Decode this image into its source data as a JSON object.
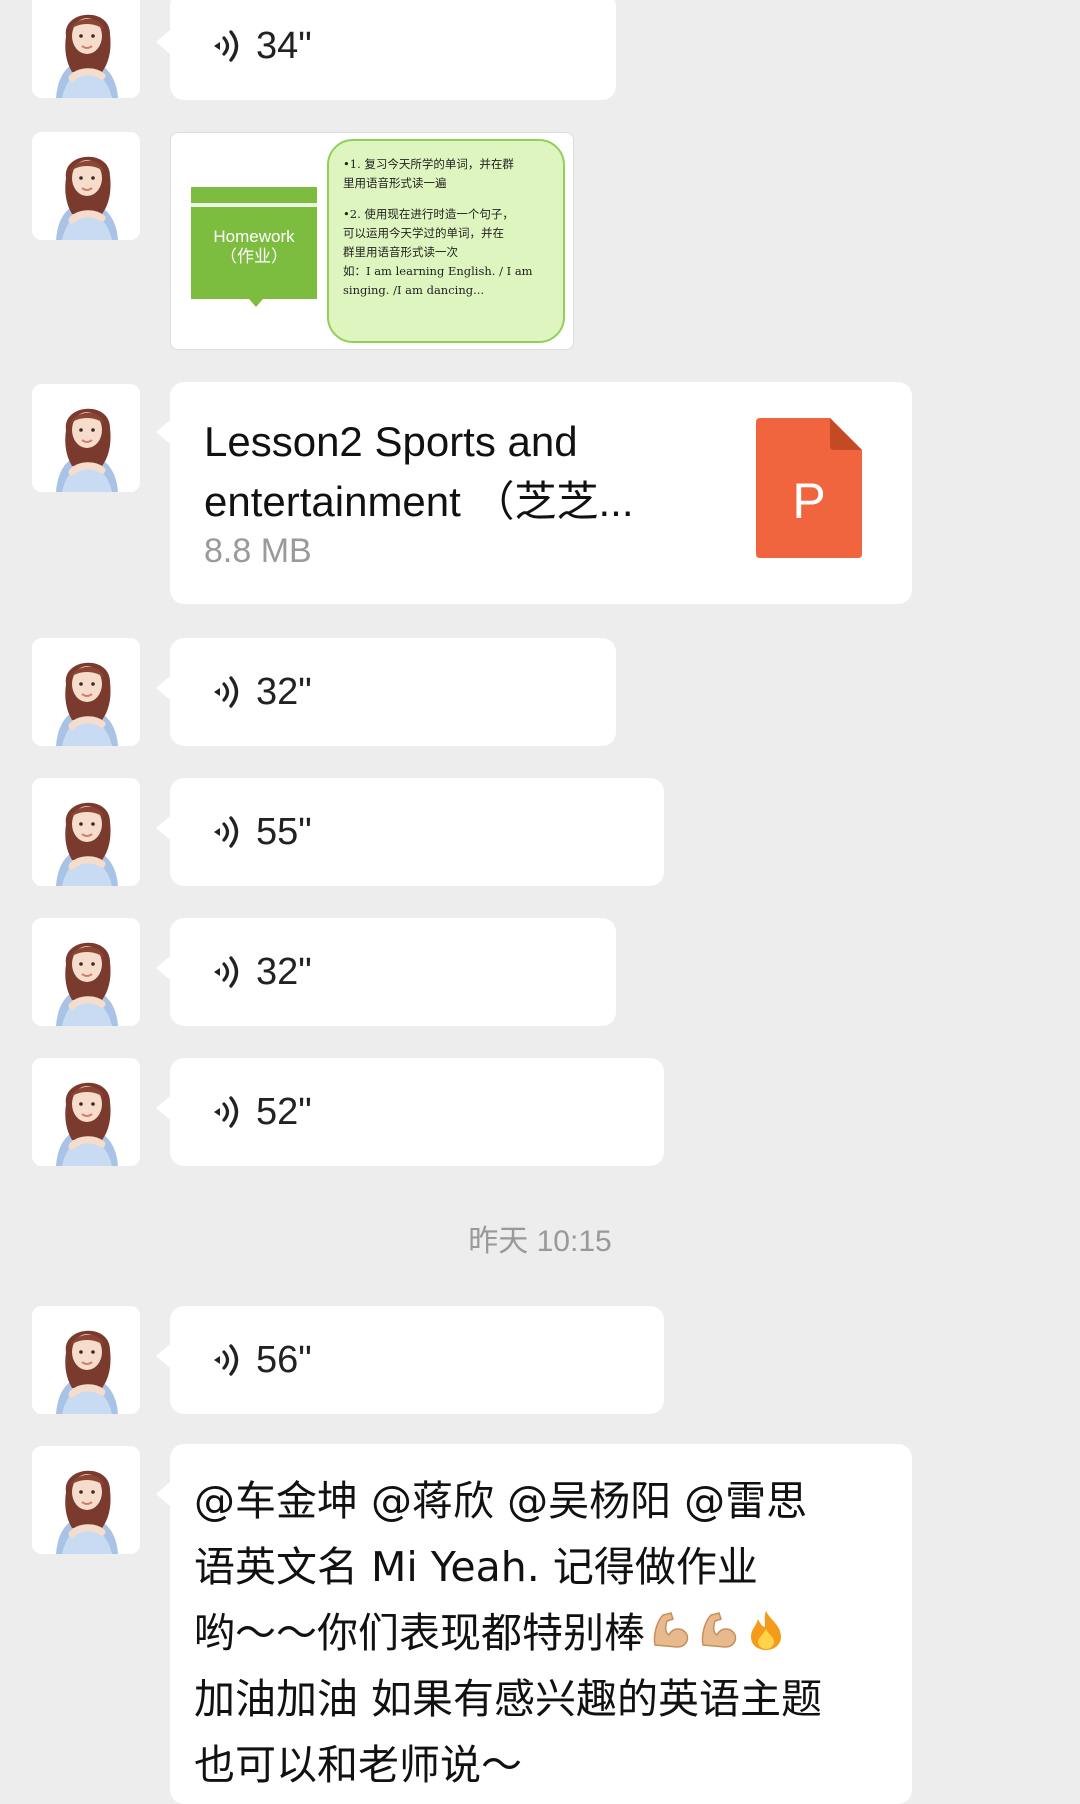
{
  "messages": [
    {
      "type": "voice",
      "duration": "34\""
    },
    {
      "type": "image",
      "slide": {
        "title": "Homework",
        "subtitle": "（作业）",
        "lines": [
          "•1. 复习今天所学的单词，并在群",
          "里用语音形式读一遍",
          "•2. 使用现在进行时造一个句子，",
          "可以运用今天学过的单词，并在",
          "群里用语音形式读一次",
          "如：I am learning English. / I am",
          "singing. /I am dancing..."
        ]
      }
    },
    {
      "type": "file",
      "name_line1": "Lesson2 Sports and",
      "name_line2": "entertainment （芝芝...",
      "size": "8.8 MB",
      "icon_letter": "P",
      "icon_color": "#f0653d"
    },
    {
      "type": "voice",
      "duration": "32\""
    },
    {
      "type": "voice",
      "duration": "55\""
    },
    {
      "type": "voice",
      "duration": "32\""
    },
    {
      "type": "voice",
      "duration": "52\""
    },
    {
      "type": "voice",
      "duration": "56\""
    },
    {
      "type": "text",
      "lines": [
        "@车金坤 @蒋欣 @吴杨阳 @雷思",
        "语英文名 Mi Yeah. 记得做作业",
        "哟～～你们表现都特别棒",
        "加油加油 如果有感兴趣的英语主题",
        "也可以和老师说～"
      ],
      "emoji": [
        "flexed-biceps-icon",
        "flexed-biceps-icon",
        "fire-icon"
      ]
    }
  ],
  "timestamp": "昨天 10:15",
  "colors": {
    "background": "#ededed",
    "bubble": "#ffffff",
    "slide_green": "#7cbd3f",
    "slide_note": "#dff5bf"
  }
}
